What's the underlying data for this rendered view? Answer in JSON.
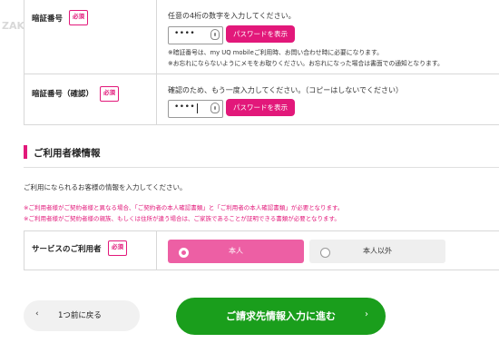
{
  "pin_section": {
    "label": "暗証番号",
    "required_badge": "必須",
    "instruction": "任意の4桁の数字を入力してください。",
    "input_value": "••••",
    "show_password_label": "パスワードを表示",
    "notes": [
      "※暗証番号は、my UQ mobileご利用時、お問い合わせ時に必要になります。",
      "※お忘れにならないようにメモをお取りください。お忘れになった場合は書面での通知となります。"
    ]
  },
  "pin_confirm_section": {
    "label": "暗証番号（確認）",
    "required_badge": "必須",
    "instruction": "確認のため、もう一度入力してください。（コピーはしないでください）",
    "input_value": "••••",
    "show_password_label": "パスワードを表示"
  },
  "user_info": {
    "heading": "ご利用者様情報",
    "description": "ご利用になられるお客様の情報を入力してください。",
    "warnings": [
      "※ご利用者様がご契約者様と異なる場合、「ご契約者の本人確認書類」と「ご利用者の本人確認書類」が必要となります。",
      "※ご利用者様がご契約者様の親族、もしくは住所が違う場合は、ご家族であることが証明できる書類が必要となります。"
    ],
    "service_user_label": "サービスのご利用者",
    "required_badge": "必須",
    "options": [
      {
        "label": "本人",
        "selected": true
      },
      {
        "label": "本人以外",
        "selected": false
      }
    ]
  },
  "nav": {
    "back_label": "1つ前に戻る",
    "next_label": "ご請求先情報入力に進む"
  },
  "colors": {
    "brand_pink": "#e2187a",
    "selected_option": "#ed5fa4",
    "next_green": "#1a9e1c"
  },
  "watermark": "ZAK"
}
